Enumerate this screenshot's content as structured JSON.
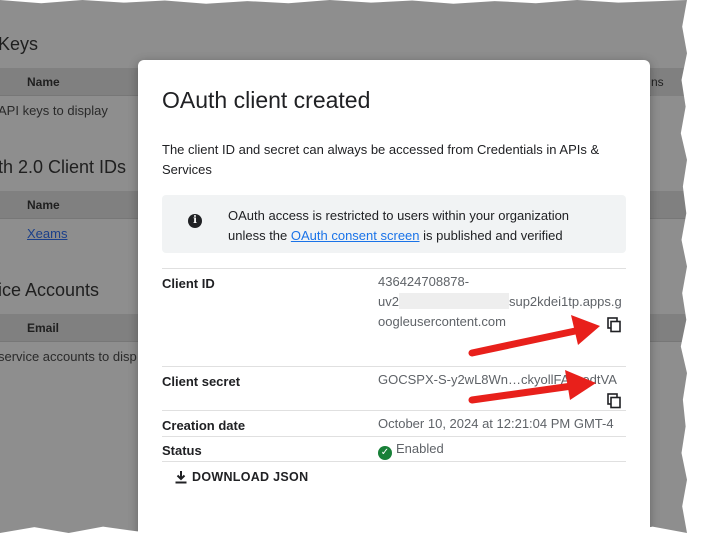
{
  "background": {
    "api_keys_title": "Keys",
    "api_keys_header_name": "Name",
    "api_keys_header_right": "ns",
    "api_keys_empty": "API keys to display",
    "oauth_title": "th 2.0 Client IDs",
    "oauth_header_name": "Name",
    "oauth_client_link": "Xeams",
    "service_title": "ice Accounts",
    "service_header_email": "Email",
    "service_empty": "service accounts to disp"
  },
  "dialog": {
    "title": "OAuth client created",
    "description": "The client ID and secret can always be accessed from Credentials in APIs & Services",
    "notice": {
      "icon": "info-icon",
      "text_before": "OAuth access is restricted to users within your organization unless the ",
      "link": "OAuth consent screen",
      "text_after": " is published and verified"
    },
    "client_id": {
      "label": "Client ID",
      "value_line1": "436424708878-",
      "value_line2_start": "uv2",
      "value_line2_end": "sup2kdei1tp.apps.g",
      "value_line3": "oogleusercontent.com",
      "copy_icon": "copy-icon"
    },
    "client_secret": {
      "label": "Client secret",
      "value": "GOCSPX-S-y2wL8Wn…ckyollFA…odtVA",
      "copy_icon": "copy-icon"
    },
    "creation_date": {
      "label": "Creation date",
      "value": "October 10, 2024 at 12:21:04 PM GMT-4"
    },
    "status": {
      "label": "Status",
      "value": "Enabled",
      "icon": "check-circle-icon",
      "color": "#188038"
    },
    "download_button": {
      "label": "DOWNLOAD JSON",
      "icon": "download-icon"
    }
  },
  "annotations": {
    "arrow_color": "#e8201b"
  }
}
